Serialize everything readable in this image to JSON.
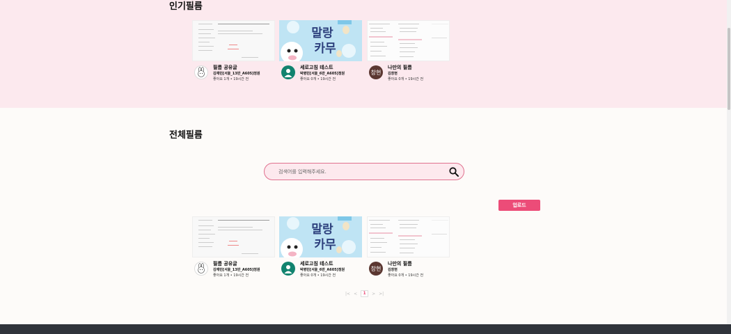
{
  "popular": {
    "title": "인기필름",
    "cards": [
      {
        "title": "필름 공유글",
        "author": "김재민[서울_13반_A605]정원",
        "stats": "좋아요 1개 • 19시간 전"
      },
      {
        "title": "세로고침 테스트",
        "author": "박병민[서울_6반_A605]정원",
        "stats": "좋아요 0개 • 19시간 전"
      },
      {
        "title": "나만의 필름",
        "author": "김창현",
        "stats": "좋아요 0개 • 19시간 전",
        "avatar_text": "창현"
      }
    ]
  },
  "all": {
    "title": "전체필름",
    "cards": [
      {
        "title": "필름 공유글",
        "author": "김재민[서울_13반_A605]정원",
        "stats": "좋아요 1개 • 19시간 전"
      },
      {
        "title": "세로고침 테스트",
        "author": "박병민[서울_6반_A605]정원",
        "stats": "좋아요 0개 • 19시간 전"
      },
      {
        "title": "나만의 필름",
        "author": "김창현",
        "stats": "좋아요 0개 • 19시간 전",
        "avatar_text": "창현"
      }
    ]
  },
  "poster_text": {
    "line1": "말랑",
    "line2": "카무"
  },
  "search": {
    "placeholder": "검색어를 입력해주세요.",
    "icon": "search-icon"
  },
  "upload_label": "업로드",
  "pagination": {
    "first": "|<",
    "prev": "<",
    "current": "1",
    "next": ">",
    "last": ">|"
  },
  "colors": {
    "accent": "#ec4c78",
    "popular_bg": "#fce9ee",
    "page_bg": "#fdfbf9",
    "footer": "#30343b"
  }
}
